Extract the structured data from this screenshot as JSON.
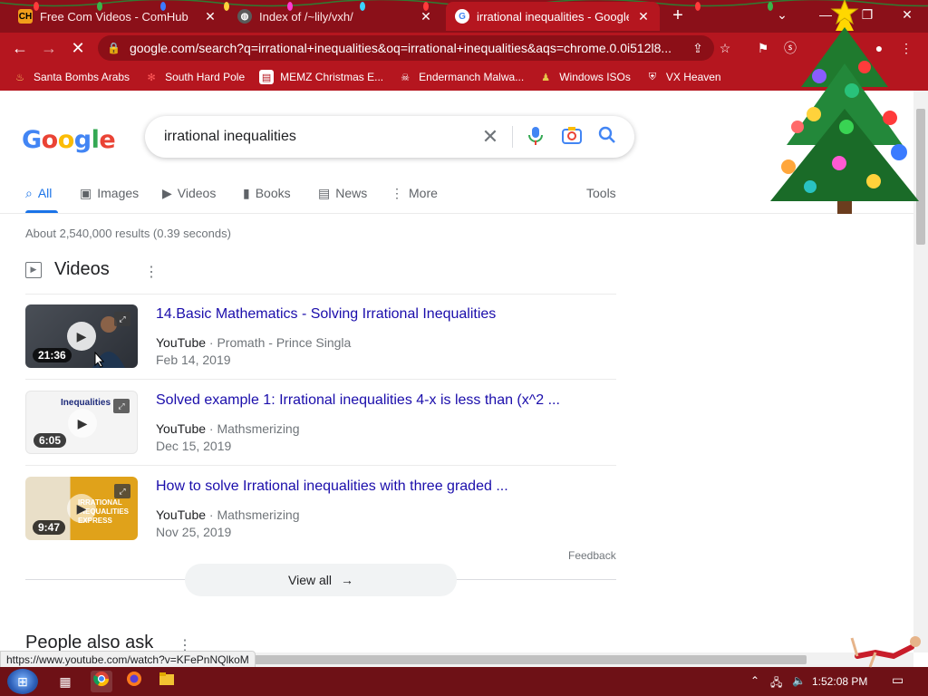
{
  "browser": {
    "tabs": [
      {
        "title": "Free Com Videos - ComHub",
        "icon": "comhub-favicon",
        "active": false
      },
      {
        "title": "Index of /~lily/vxh/",
        "icon": "globe-icon",
        "active": false
      },
      {
        "title": "irrational inequalities - Google Se",
        "icon": "google-favicon",
        "active": true
      }
    ],
    "url": "google.com/search?q=irrational+inequalities&oq=irrational+inequalities&aqs=chrome.0.0i512l8...",
    "bookmarks": [
      {
        "label": "Santa Bombs Arabs",
        "icon": "flame-icon"
      },
      {
        "label": "South Hard Pole",
        "icon": "snowflake-icon"
      },
      {
        "label": "MEMZ Christmas E...",
        "icon": "document-icon"
      },
      {
        "label": "Endermanch Malwa...",
        "icon": "mask-icon"
      },
      {
        "label": "Windows ISOs",
        "icon": "person-icon"
      },
      {
        "label": "VX Heaven",
        "icon": "shield-icon"
      }
    ]
  },
  "search": {
    "query": "irrational inequalities",
    "logo_letters": [
      "G",
      "o",
      "o",
      "g",
      "l",
      "e"
    ]
  },
  "nav": {
    "tabs": [
      "All",
      "Images",
      "Videos",
      "Books",
      "News",
      "More"
    ],
    "tools": "Tools"
  },
  "results": {
    "stats": "About 2,540,000 results (0.39 seconds)",
    "videos_heading": "Videos",
    "videos": [
      {
        "title": "14.Basic Mathematics - Solving Irrational Inequalities",
        "source": "YouTube",
        "channel": "Promath - Prince Singla",
        "date": "Feb 14, 2019",
        "duration": "21:36"
      },
      {
        "title": "Solved example 1: Irrational inequalities 4-x is less than (x^2 ...",
        "source": "YouTube",
        "channel": "Mathsmerizing",
        "date": "Dec 15, 2019",
        "duration": "6:05",
        "thumb_text": "Inequalities"
      },
      {
        "title": "How to solve Irrational inequalities with three graded ...",
        "source": "YouTube",
        "channel": "Mathsmerizing",
        "date": "Nov 25, 2019",
        "duration": "9:47",
        "thumb_text": "IRRATIONAL INEQUALITIES EXPRESS"
      }
    ],
    "feedback": "Feedback",
    "view_all": "View all",
    "people_also_ask": "People also ask"
  },
  "status_url": "https://www.youtube.com/watch?v=KFePnNQlkoM",
  "taskbar": {
    "clock": "1:52:08 PM"
  },
  "colors": {
    "chrome_dark": "#8b1019",
    "chrome": "#b5161f",
    "link": "#1a0dab",
    "accent": "#1a73e8"
  }
}
